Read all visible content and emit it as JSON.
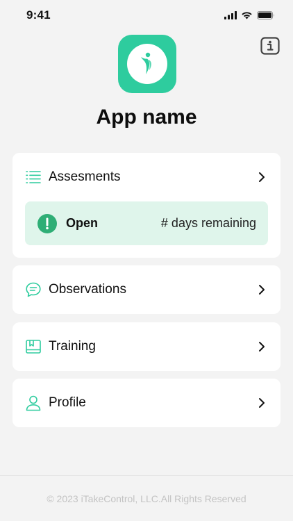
{
  "status_bar": {
    "time": "9:41"
  },
  "header": {
    "app_name": "App name",
    "info_icon": "info-icon",
    "accent_color": "#2ecc9e"
  },
  "menu": {
    "assessments": {
      "label": "Assesments",
      "icon": "list-icon",
      "status": {
        "state": "Open",
        "remaining": "# days remaining",
        "panel_color": "#dff5eb"
      }
    },
    "observations": {
      "label": "Observations",
      "icon": "chat-bubble-icon"
    },
    "training": {
      "label": "Training",
      "icon": "book-icon"
    },
    "profile": {
      "label": "Profile",
      "icon": "person-icon"
    }
  },
  "footer": {
    "copyright": "© 2023 iTakeControl, LLC.All Rights Reserved"
  }
}
